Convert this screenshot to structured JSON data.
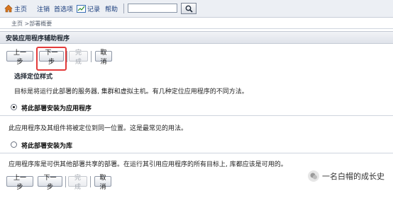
{
  "toolbar": {
    "home": "主页",
    "logout": "注销",
    "preferences": "首选项",
    "log": "记录",
    "help": "帮助",
    "search_value": ""
  },
  "breadcrumb": "主页 >部署概要",
  "panel_title": "安装应用程序辅助程序",
  "buttons": {
    "back": "上一步",
    "next": "下一步",
    "finish": "完成",
    "cancel": "取消"
  },
  "section": {
    "heading": "选择定位样式",
    "intro": "目标是将运行此部署的服务器, 集群和虚拟主机。有几种定位应用程序的不同方法。",
    "option1_label": "将此部署安装为应用程序",
    "option1_desc": "此应用程序及其组件将被定位到同一位置。这是最常见的用法。",
    "option2_label": "将此部署安装为库",
    "option2_desc": "应用程序库是可供其他部署共享的部署。在运行其引用应用程序的所有目标上, 库都应该是可用的。"
  },
  "watermark": "一名白帽的成长史",
  "colors": {
    "highlight": "#e33b3b",
    "link": "#1a3d7c"
  }
}
